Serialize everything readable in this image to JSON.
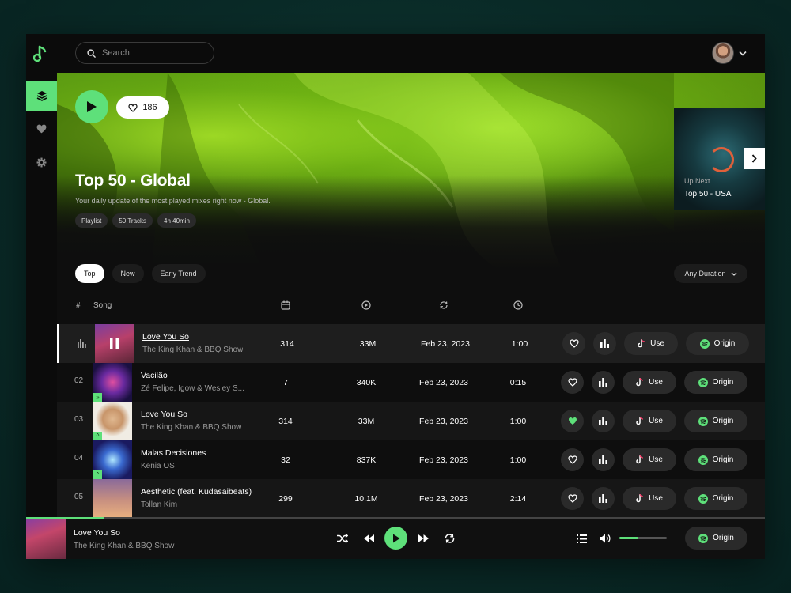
{
  "colors": {
    "accent": "#5ee07a",
    "background": "#0e0e0e",
    "surface": "#2a2a2a"
  },
  "search": {
    "placeholder": "Search"
  },
  "hero": {
    "likes": "186",
    "title": "Top 50 - Global",
    "subtitle": "Your daily update of the most played  mixes right now - Global.",
    "tags": [
      "Playlist",
      "50 Tracks",
      "4h 40min"
    ],
    "up_next_label": "Up Next",
    "up_next_title": "Top 50 - USA"
  },
  "filters": [
    "Top",
    "New",
    "Early Trend"
  ],
  "duration_filter": "Any Duration",
  "table": {
    "col_num": "#",
    "col_song": "Song",
    "header_icons": [
      "calendar-icon",
      "play-count-icon",
      "repeat-icon",
      "clock-icon"
    ],
    "use_label": "Use",
    "origin_label": "Origin",
    "rows": [
      {
        "num": "",
        "title": "Love You So",
        "artist": "The King Khan & BBQ Show",
        "v1": "314",
        "plays": "33M",
        "date": "Feb 23, 2023",
        "duration": "1:00",
        "liked": false,
        "playing": true,
        "trend": ""
      },
      {
        "num": "02",
        "title": "Vacilão",
        "artist": "Zé Felipe, Igow & Wesley S...",
        "v1": "7",
        "plays": "340K",
        "date": "Feb 23, 2023",
        "duration": "0:15",
        "liked": false,
        "playing": false,
        "trend": "double-up"
      },
      {
        "num": "03",
        "title": "Love You So",
        "artist": "The King Khan & BBQ Show",
        "v1": "314",
        "plays": "33M",
        "date": "Feb 23, 2023",
        "duration": "1:00",
        "liked": true,
        "playing": false,
        "trend": "up"
      },
      {
        "num": "04",
        "title": "Malas Decisiones",
        "artist": "Kenia OS",
        "v1": "32",
        "plays": "837K",
        "date": "Feb 23, 2023",
        "duration": "1:00",
        "liked": false,
        "playing": false,
        "trend": "up"
      },
      {
        "num": "05",
        "title": "Aesthetic (feat. Kudasaibeats)",
        "artist": "Tollan Kim",
        "v1": "299",
        "plays": "10.1M",
        "date": "Feb 23, 2023",
        "duration": "2:14",
        "liked": false,
        "playing": false,
        "trend": ""
      }
    ]
  },
  "player": {
    "title": "Love You So",
    "artist": "The King Khan & BBQ Show",
    "progress": 0.105,
    "volume": 0.4,
    "origin_label": "Origin"
  }
}
